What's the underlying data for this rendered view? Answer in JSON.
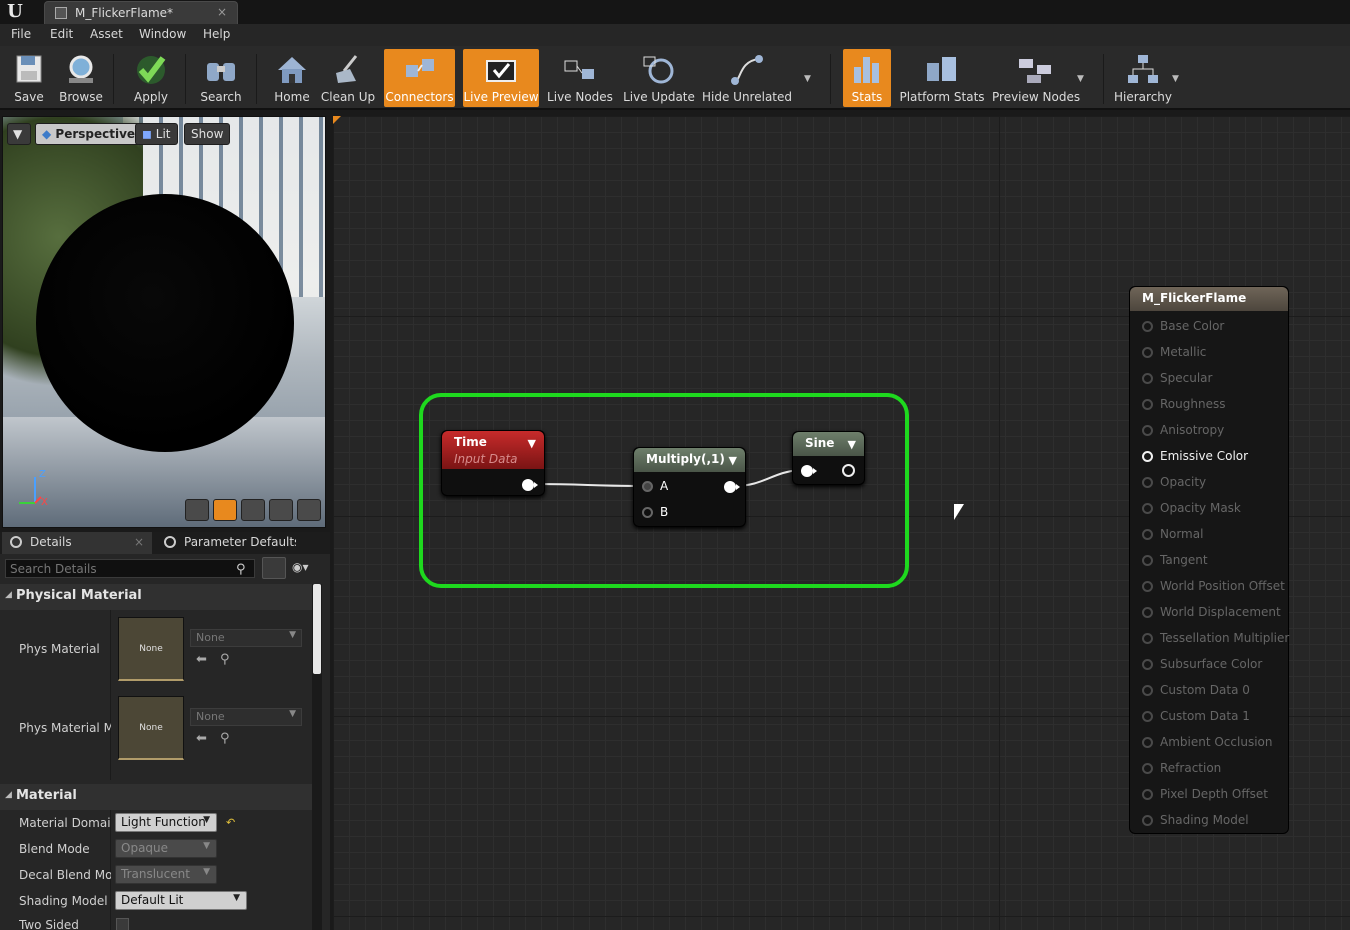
{
  "window": {
    "tab_title": "M_FlickerFlame*",
    "tab_close": "×"
  },
  "menu": [
    "File",
    "Edit",
    "Asset",
    "Window",
    "Help"
  ],
  "toolbar": {
    "save": "Save",
    "browse": "Browse",
    "apply": "Apply",
    "search": "Search",
    "home": "Home",
    "clean_up": "Clean Up",
    "connectors": "Connectors",
    "live_preview": "Live Preview",
    "live_nodes": "Live Nodes",
    "live_update": "Live Update",
    "hide_unrelated": "Hide Unrelated",
    "stats": "Stats",
    "platform_stats": "Platform Stats",
    "preview_nodes": "Preview Nodes",
    "hierarchy": "Hierarchy",
    "active_buttons": [
      "Connectors",
      "Live Preview",
      "Stats"
    ],
    "active_color": "#e8891e"
  },
  "viewport": {
    "perspective": "Perspective",
    "lit": "Lit",
    "show": "Show",
    "axis_z": "Z",
    "axis_x": "X"
  },
  "details": {
    "tab_details": "Details",
    "tab_param_defaults": "Parameter Defaults",
    "search_placeholder": "Search Details",
    "physical_material": {
      "header": "Physical Material",
      "phys_material_label": "Phys Material",
      "phys_material_thumb": "None",
      "phys_material_value": "None",
      "phys_material_mask_label": "Phys Material Mask",
      "phys_material_mask_thumb": "None",
      "phys_material_mask_value": "None"
    },
    "material": {
      "header": "Material",
      "domain_label": "Material Domain",
      "domain_value": "Light Function",
      "blend_label": "Blend Mode",
      "blend_value": "Opaque",
      "decal_label": "Decal Blend Mode",
      "decal_value": "Translucent",
      "shading_label": "Shading Model",
      "shading_value": "Default Lit",
      "two_sided_label": "Two Sided"
    }
  },
  "graph": {
    "highlight_color": "#1ed91e",
    "time_node": {
      "title": "Time",
      "subtitle": "Input Data"
    },
    "multiply_node": {
      "title": "Multiply(,1)",
      "pin_a": "A",
      "pin_b": "B"
    },
    "sine_node": {
      "title": "Sine"
    },
    "result_node": {
      "title": "M_FlickerFlame",
      "pins": [
        "Base Color",
        "Metallic",
        "Specular",
        "Roughness",
        "Anisotropy",
        "Emissive Color",
        "Opacity",
        "Opacity Mask",
        "Normal",
        "Tangent",
        "World Position Offset",
        "World Displacement",
        "Tessellation Multiplier",
        "Subsurface Color",
        "Custom Data 0",
        "Custom Data 1",
        "Ambient Occlusion",
        "Refraction",
        "Pixel Depth Offset",
        "Shading Model"
      ],
      "active_pin": "Emissive Color"
    }
  }
}
